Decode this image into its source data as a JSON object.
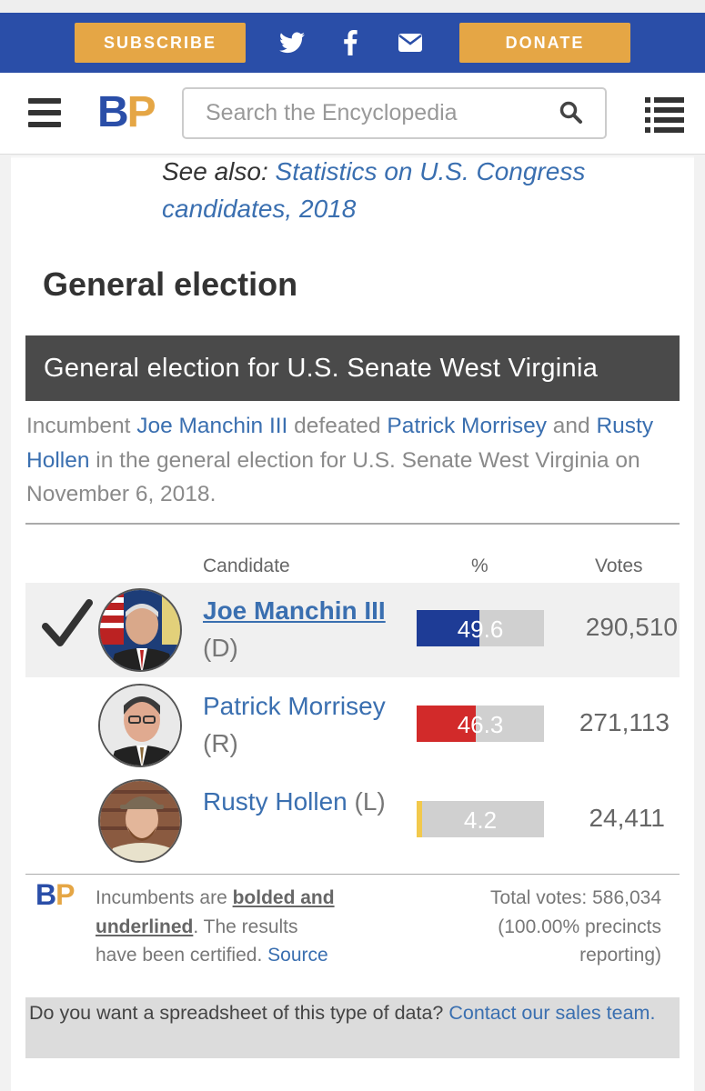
{
  "header": {
    "subscribe_label": "SUBSCRIBE",
    "donate_label": "DONATE",
    "social_icons": [
      "twitter-icon",
      "facebook-icon",
      "email-icon"
    ],
    "brand_b": "B",
    "brand_p": "P",
    "search_placeholder": "Search the Encyclopedia",
    "colors": {
      "blue": "#2a4ea8",
      "orange": "#e5a645"
    }
  },
  "see_also": {
    "prefix": "See also:",
    "link": "Statistics on U.S. Congress candidates, 2018"
  },
  "section_title": "General election",
  "race": {
    "title": "General election for U.S. Senate West Virginia",
    "summary": {
      "w1": "Incumbent",
      "winner": "Joe Manchin III",
      "w2": "defeated",
      "loser1": "Patrick Morrisey",
      "w3": "and",
      "loser2": "Rusty Hollen",
      "w4": "in the general election for U.S. Senate West Virginia on November 6, 2018."
    },
    "columns": {
      "candidate": "Candidate",
      "pct": "%",
      "votes": "Votes"
    },
    "candidates": [
      {
        "name": "Joe Manchin III",
        "party": "(D)",
        "pct": "49.6",
        "pct_value": 49.6,
        "votes": "290,510",
        "color": "#1e3c96",
        "winner": true,
        "incumbent": true
      },
      {
        "name": "Patrick Morrisey",
        "party": "(R)",
        "pct": "46.3",
        "pct_value": 46.3,
        "votes": "271,113",
        "color": "#d22a2a",
        "winner": false,
        "incumbent": false
      },
      {
        "name": "Rusty Hollen",
        "party": "(L)",
        "pct": "4.2",
        "pct_value": 4.2,
        "votes": "24,411",
        "color": "#f2c94c",
        "winner": false,
        "incumbent": false
      }
    ],
    "footer": {
      "brand_b": "B",
      "brand_p": "P",
      "note_prefix": "Incumbents are",
      "note_bold": "bolded and underlined",
      "note_suffix": ". The results have been certified.",
      "source": "Source",
      "total": "Total votes: 586,034",
      "precincts": "(100.00% precincts reporting)"
    }
  },
  "sales": {
    "text": "Do you want a spreadsheet of this type of data?",
    "link": "Contact our sales team."
  }
}
